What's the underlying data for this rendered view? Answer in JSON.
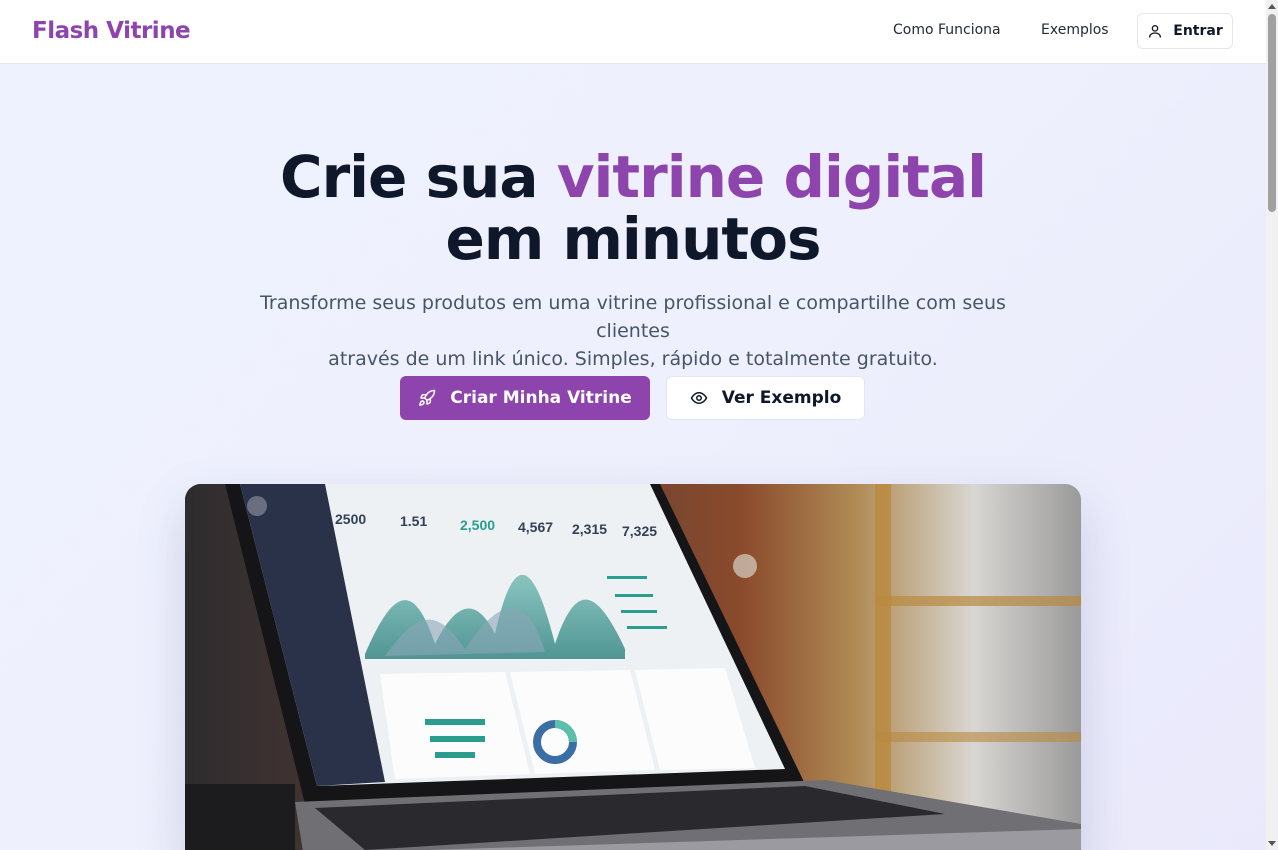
{
  "header": {
    "logo": "Flash Vitrine",
    "nav": [
      "Como Funciona",
      "Exemplos"
    ],
    "login_label": "Entrar"
  },
  "hero": {
    "title_part1": "Crie sua ",
    "title_accent": "vitrine digital",
    "title_part2": "em minutos",
    "subtitle_line1": "Transforme seus produtos em uma vitrine profissional e compartilhe com seus clientes",
    "subtitle_line2": "através de um link único. Simples, rápido e totalmente gratuito.",
    "primary_cta": "Criar Minha Vitrine",
    "secondary_cta": "Ver Exemplo"
  },
  "colors": {
    "brand": "#8e44ad",
    "text_dark": "#0f172a",
    "text_muted": "#475569"
  },
  "icons": {
    "login": "user-icon",
    "primary_cta": "rocket-icon",
    "secondary_cta": "eye-icon"
  },
  "image": {
    "description_name": "laptop-dashboard-photo",
    "dashboard_stats": [
      "2500",
      "1.51",
      "2,500",
      "4,567",
      "2,315",
      "7,325"
    ]
  }
}
